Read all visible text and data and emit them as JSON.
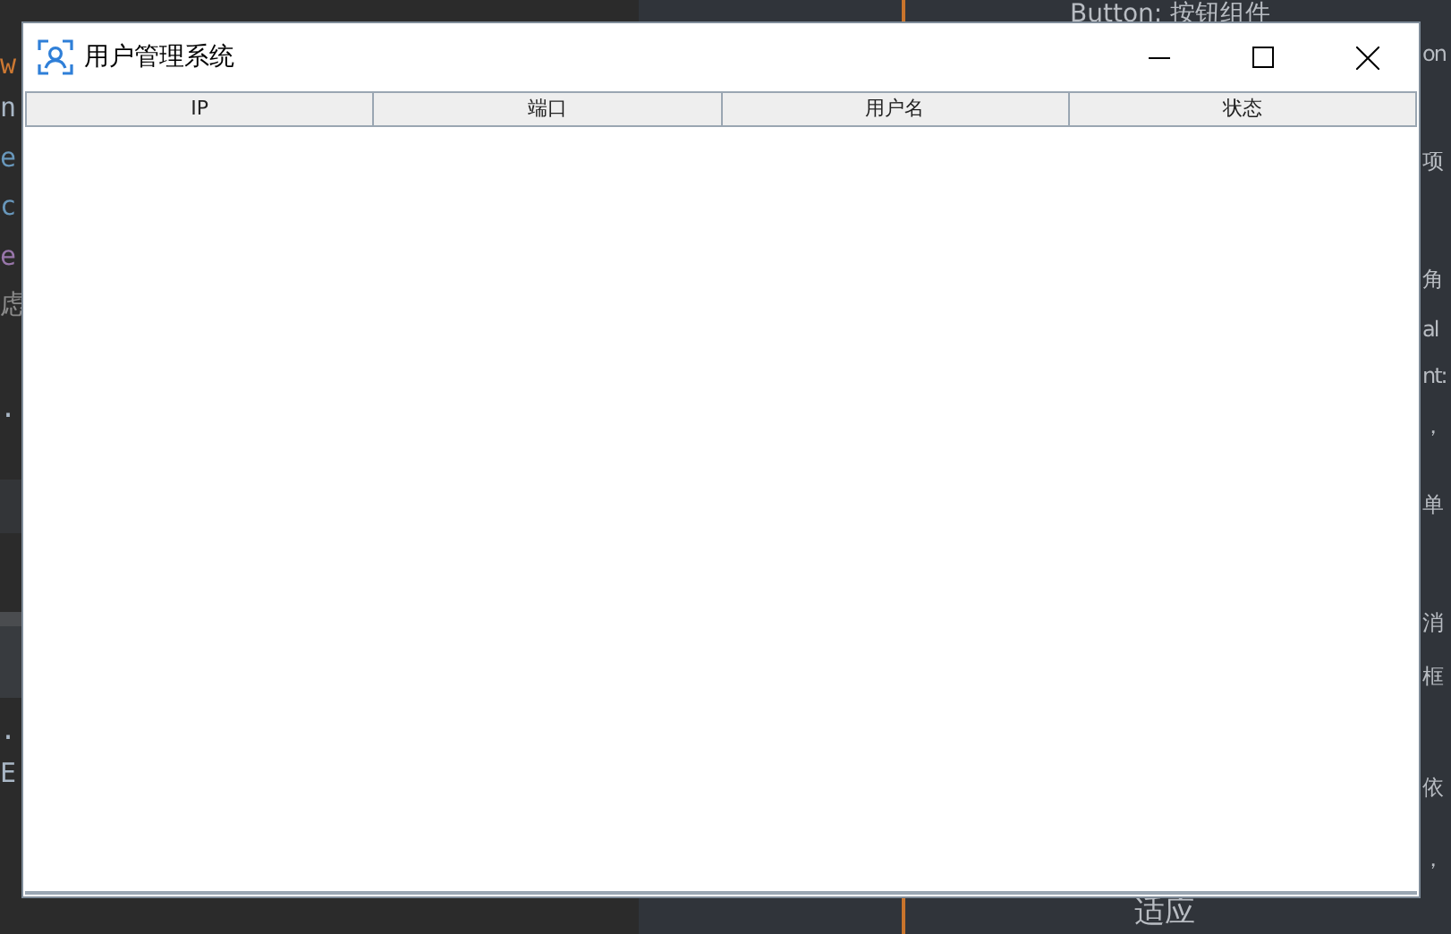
{
  "background": {
    "left_fragments": [
      "w",
      "n",
      "e",
      "c",
      "e",
      "虑",
      ".",
      ".",
      "E"
    ],
    "right_fragments": [
      "on",
      "项",
      "角",
      "al",
      "nt:",
      "，",
      "单",
      "消",
      "框",
      "依",
      "，"
    ],
    "top_text": "Button: 按钮组件",
    "bottom_text": "适应"
  },
  "window": {
    "title": "用户管理系统"
  },
  "table": {
    "columns": [
      "IP",
      "端口",
      "用户名",
      "状态"
    ]
  }
}
